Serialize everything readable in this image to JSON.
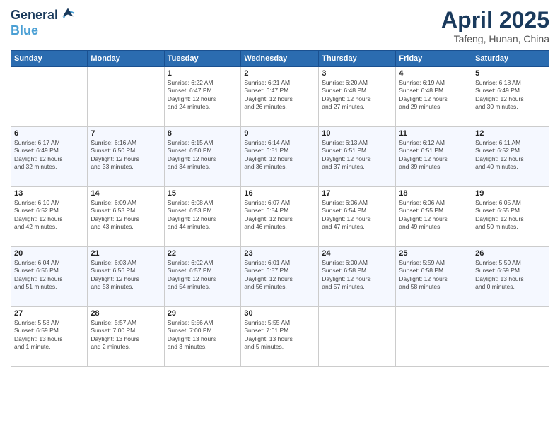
{
  "header": {
    "logo_line1": "General",
    "logo_line2": "Blue",
    "month": "April 2025",
    "location": "Tafeng, Hunan, China"
  },
  "days_of_week": [
    "Sunday",
    "Monday",
    "Tuesday",
    "Wednesday",
    "Thursday",
    "Friday",
    "Saturday"
  ],
  "weeks": [
    [
      {
        "day": "",
        "info": ""
      },
      {
        "day": "",
        "info": ""
      },
      {
        "day": "1",
        "info": "Sunrise: 6:22 AM\nSunset: 6:47 PM\nDaylight: 12 hours\nand 24 minutes."
      },
      {
        "day": "2",
        "info": "Sunrise: 6:21 AM\nSunset: 6:47 PM\nDaylight: 12 hours\nand 26 minutes."
      },
      {
        "day": "3",
        "info": "Sunrise: 6:20 AM\nSunset: 6:48 PM\nDaylight: 12 hours\nand 27 minutes."
      },
      {
        "day": "4",
        "info": "Sunrise: 6:19 AM\nSunset: 6:48 PM\nDaylight: 12 hours\nand 29 minutes."
      },
      {
        "day": "5",
        "info": "Sunrise: 6:18 AM\nSunset: 6:49 PM\nDaylight: 12 hours\nand 30 minutes."
      }
    ],
    [
      {
        "day": "6",
        "info": "Sunrise: 6:17 AM\nSunset: 6:49 PM\nDaylight: 12 hours\nand 32 minutes."
      },
      {
        "day": "7",
        "info": "Sunrise: 6:16 AM\nSunset: 6:50 PM\nDaylight: 12 hours\nand 33 minutes."
      },
      {
        "day": "8",
        "info": "Sunrise: 6:15 AM\nSunset: 6:50 PM\nDaylight: 12 hours\nand 34 minutes."
      },
      {
        "day": "9",
        "info": "Sunrise: 6:14 AM\nSunset: 6:51 PM\nDaylight: 12 hours\nand 36 minutes."
      },
      {
        "day": "10",
        "info": "Sunrise: 6:13 AM\nSunset: 6:51 PM\nDaylight: 12 hours\nand 37 minutes."
      },
      {
        "day": "11",
        "info": "Sunrise: 6:12 AM\nSunset: 6:51 PM\nDaylight: 12 hours\nand 39 minutes."
      },
      {
        "day": "12",
        "info": "Sunrise: 6:11 AM\nSunset: 6:52 PM\nDaylight: 12 hours\nand 40 minutes."
      }
    ],
    [
      {
        "day": "13",
        "info": "Sunrise: 6:10 AM\nSunset: 6:52 PM\nDaylight: 12 hours\nand 42 minutes."
      },
      {
        "day": "14",
        "info": "Sunrise: 6:09 AM\nSunset: 6:53 PM\nDaylight: 12 hours\nand 43 minutes."
      },
      {
        "day": "15",
        "info": "Sunrise: 6:08 AM\nSunset: 6:53 PM\nDaylight: 12 hours\nand 44 minutes."
      },
      {
        "day": "16",
        "info": "Sunrise: 6:07 AM\nSunset: 6:54 PM\nDaylight: 12 hours\nand 46 minutes."
      },
      {
        "day": "17",
        "info": "Sunrise: 6:06 AM\nSunset: 6:54 PM\nDaylight: 12 hours\nand 47 minutes."
      },
      {
        "day": "18",
        "info": "Sunrise: 6:06 AM\nSunset: 6:55 PM\nDaylight: 12 hours\nand 49 minutes."
      },
      {
        "day": "19",
        "info": "Sunrise: 6:05 AM\nSunset: 6:55 PM\nDaylight: 12 hours\nand 50 minutes."
      }
    ],
    [
      {
        "day": "20",
        "info": "Sunrise: 6:04 AM\nSunset: 6:56 PM\nDaylight: 12 hours\nand 51 minutes."
      },
      {
        "day": "21",
        "info": "Sunrise: 6:03 AM\nSunset: 6:56 PM\nDaylight: 12 hours\nand 53 minutes."
      },
      {
        "day": "22",
        "info": "Sunrise: 6:02 AM\nSunset: 6:57 PM\nDaylight: 12 hours\nand 54 minutes."
      },
      {
        "day": "23",
        "info": "Sunrise: 6:01 AM\nSunset: 6:57 PM\nDaylight: 12 hours\nand 56 minutes."
      },
      {
        "day": "24",
        "info": "Sunrise: 6:00 AM\nSunset: 6:58 PM\nDaylight: 12 hours\nand 57 minutes."
      },
      {
        "day": "25",
        "info": "Sunrise: 5:59 AM\nSunset: 6:58 PM\nDaylight: 12 hours\nand 58 minutes."
      },
      {
        "day": "26",
        "info": "Sunrise: 5:59 AM\nSunset: 6:59 PM\nDaylight: 13 hours\nand 0 minutes."
      }
    ],
    [
      {
        "day": "27",
        "info": "Sunrise: 5:58 AM\nSunset: 6:59 PM\nDaylight: 13 hours\nand 1 minute."
      },
      {
        "day": "28",
        "info": "Sunrise: 5:57 AM\nSunset: 7:00 PM\nDaylight: 13 hours\nand 2 minutes."
      },
      {
        "day": "29",
        "info": "Sunrise: 5:56 AM\nSunset: 7:00 PM\nDaylight: 13 hours\nand 3 minutes."
      },
      {
        "day": "30",
        "info": "Sunrise: 5:55 AM\nSunset: 7:01 PM\nDaylight: 13 hours\nand 5 minutes."
      },
      {
        "day": "",
        "info": ""
      },
      {
        "day": "",
        "info": ""
      },
      {
        "day": "",
        "info": ""
      }
    ]
  ]
}
